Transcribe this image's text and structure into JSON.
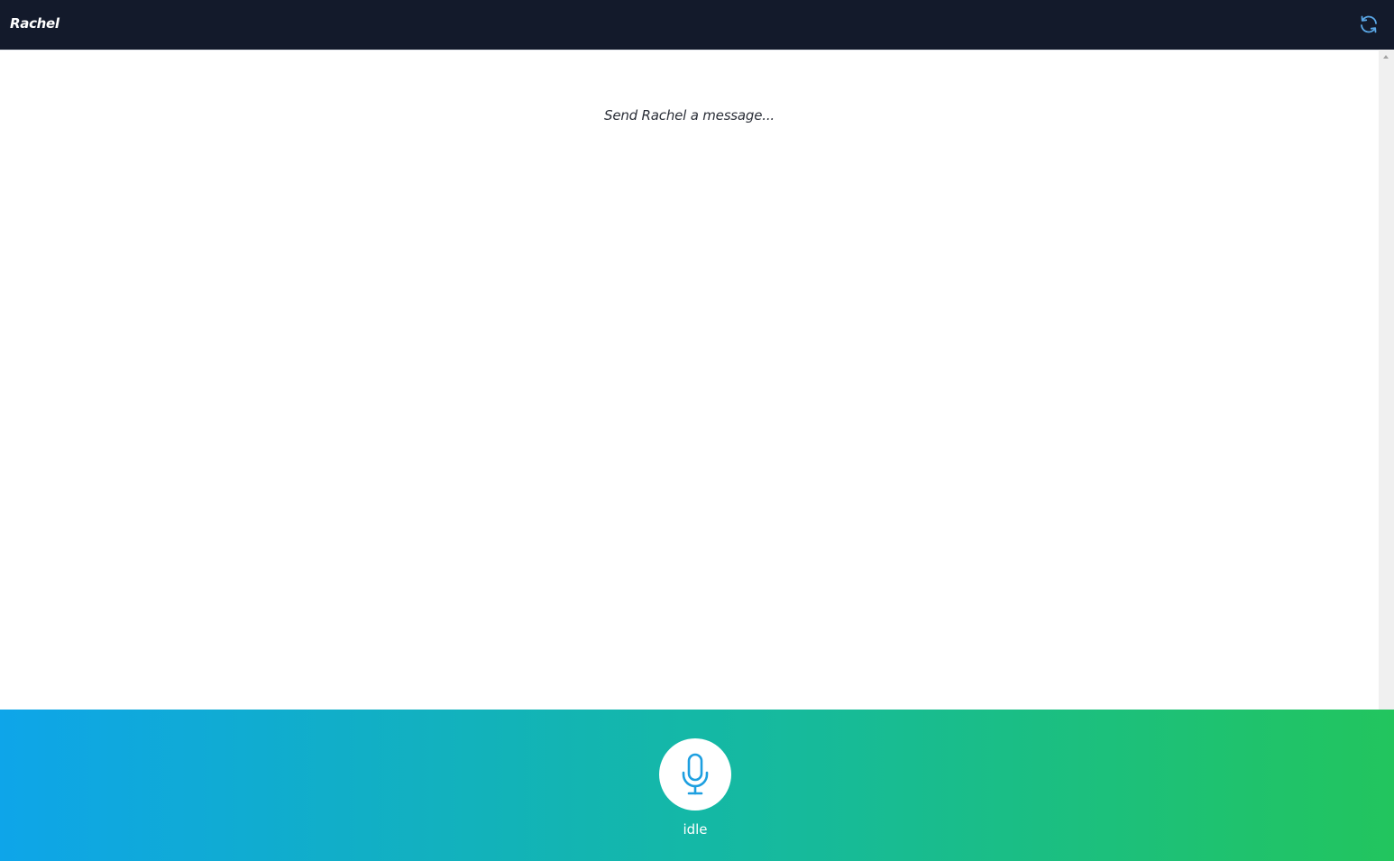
{
  "header": {
    "title": "Rachel",
    "refresh_icon": "refresh-icon"
  },
  "conversation": {
    "placeholder": "Send Rachel a message..."
  },
  "footer": {
    "mic_icon": "microphone-icon",
    "status": "idle"
  },
  "colors": {
    "header_bg": "#131a2b",
    "accent_blue": "#0ea5e9",
    "accent_green": "#22c55e"
  }
}
